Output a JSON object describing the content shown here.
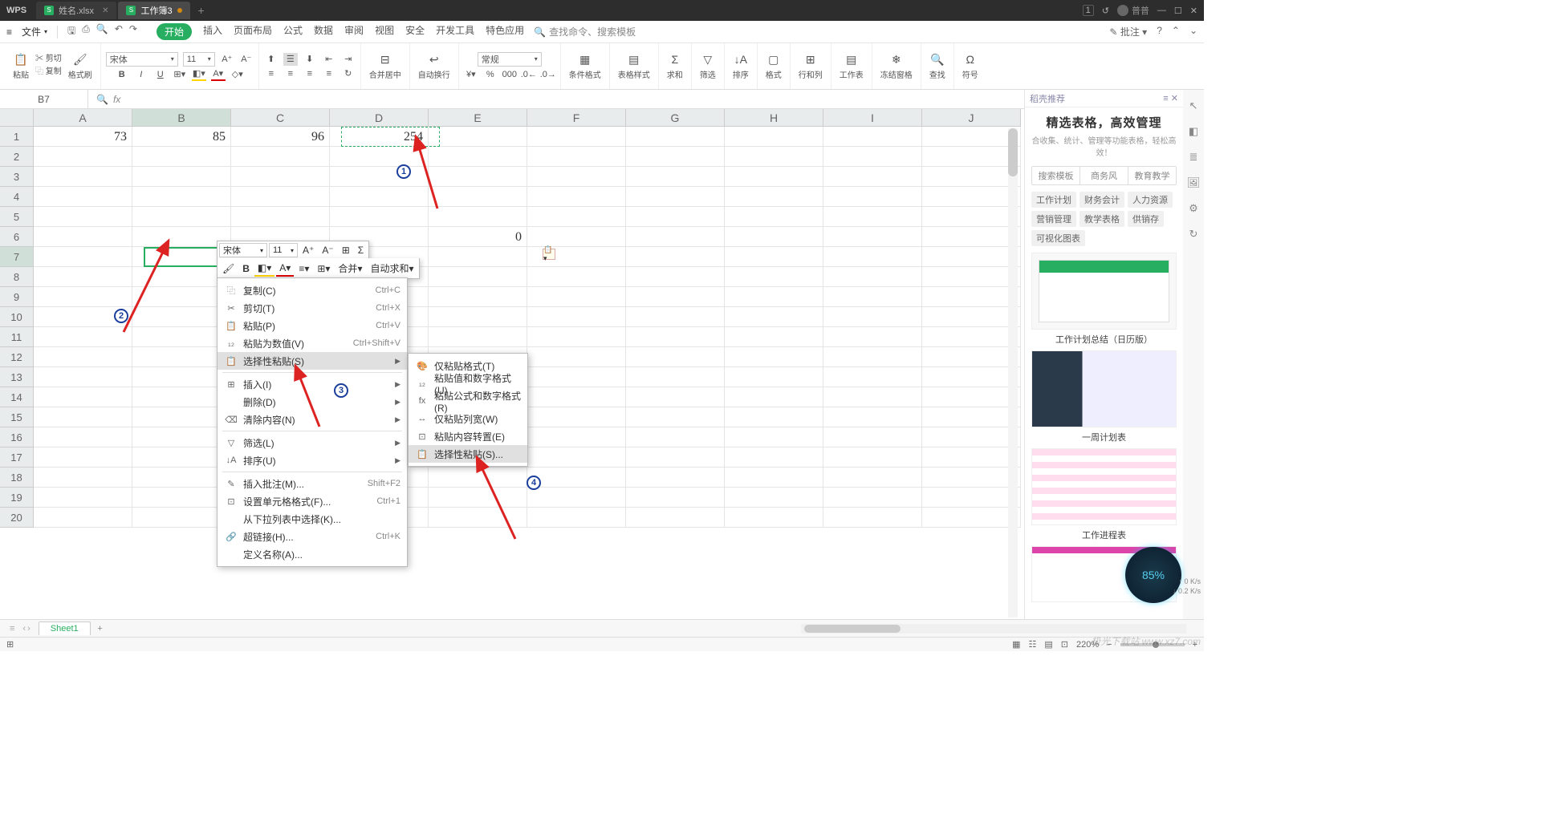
{
  "titlebar": {
    "app": "WPS",
    "tabs": [
      {
        "label": "姓名.xlsx",
        "active": false
      },
      {
        "label": "工作簿3",
        "active": true
      }
    ],
    "user": "普普",
    "badge": "1"
  },
  "menubar": {
    "file": "文件",
    "tabs": [
      "开始",
      "插入",
      "页面布局",
      "公式",
      "数据",
      "审阅",
      "视图",
      "安全",
      "开发工具",
      "特色应用"
    ],
    "activeTab": "开始",
    "searchPlaceholder": "查找命令、搜索模板",
    "right": "批注"
  },
  "ribbon": {
    "paste": "粘贴",
    "cut": "剪切",
    "copy": "复制",
    "formatPainter": "格式刷",
    "font": "宋体",
    "fontSize": "11",
    "mergeCenter": "合并居中",
    "wrap": "自动换行",
    "numberFormat": "常规",
    "cellStyle": "条件格式",
    "tableStyle": "表格样式",
    "sum": "求和",
    "filter": "筛选",
    "sort": "排序",
    "format": "格式",
    "rowcol": "行和列",
    "sheet": "工作表",
    "freeze": "冻结窗格",
    "find": "查找",
    "symbol": "符号"
  },
  "formulaBar": {
    "nameBox": "B7",
    "fx": "fx"
  },
  "columns": [
    "A",
    "B",
    "C",
    "D",
    "E",
    "F",
    "G",
    "H",
    "I",
    "J"
  ],
  "rows": 20,
  "cells": {
    "A1": "73",
    "B1": "85",
    "C1": "96",
    "D1": "254",
    "E6": "0"
  },
  "activeCell": "B7",
  "copiedCell": "D1",
  "miniToolbar": {
    "font": "宋体",
    "size": "11",
    "merge": "合并",
    "autoSum": "自动求和"
  },
  "contextMenu": [
    {
      "icon": "⿻",
      "label": "复制(C)",
      "shortcut": "Ctrl+C"
    },
    {
      "icon": "✂",
      "label": "剪切(T)",
      "shortcut": "Ctrl+X"
    },
    {
      "icon": "📋",
      "label": "粘贴(P)",
      "shortcut": "Ctrl+V"
    },
    {
      "icon": "₁₂",
      "label": "粘贴为数值(V)",
      "shortcut": "Ctrl+Shift+V"
    },
    {
      "icon": "📋",
      "label": "选择性粘贴(S)",
      "submenu": true,
      "hover": true
    },
    {
      "sep": true
    },
    {
      "icon": "⊞",
      "label": "插入(I)",
      "submenu": true
    },
    {
      "icon": "",
      "label": "删除(D)",
      "submenu": true
    },
    {
      "icon": "⌫",
      "label": "清除内容(N)",
      "submenu": true
    },
    {
      "sep": true
    },
    {
      "icon": "▽",
      "label": "筛选(L)",
      "submenu": true
    },
    {
      "icon": "↓A",
      "label": "排序(U)",
      "submenu": true
    },
    {
      "sep": true
    },
    {
      "icon": "✎",
      "label": "插入批注(M)...",
      "shortcut": "Shift+F2"
    },
    {
      "icon": "⊡",
      "label": "设置单元格格式(F)...",
      "shortcut": "Ctrl+1"
    },
    {
      "icon": "",
      "label": "从下拉列表中选择(K)..."
    },
    {
      "icon": "🔗",
      "label": "超链接(H)...",
      "shortcut": "Ctrl+K"
    },
    {
      "icon": "",
      "label": "定义名称(A)..."
    }
  ],
  "subMenu": [
    {
      "icon": "🎨",
      "label": "仅粘贴格式(T)"
    },
    {
      "icon": "₁₂",
      "label": "粘贴值和数字格式(U)"
    },
    {
      "icon": "fx",
      "label": "粘贴公式和数字格式(R)"
    },
    {
      "icon": "↔",
      "label": "仅粘贴列宽(W)"
    },
    {
      "icon": "⊡",
      "label": "粘贴内容转置(E)"
    },
    {
      "icon": "📋",
      "label": "选择性粘贴(S)...",
      "hover": true
    }
  ],
  "rightPanel": {
    "header": "稻壳推荐",
    "title": "精选表格，高效管理",
    "subtitle": "合收集、统计、管理等功能表格，轻松高效！",
    "tabs": [
      "搜索模板",
      "商务风",
      "教育教学"
    ],
    "tags": [
      "工作计划",
      "财务会计",
      "人力资源",
      "营销管理",
      "教学表格",
      "供销存",
      "可视化图表"
    ],
    "templateCaptions": [
      "",
      "工作计划总结（日历版）",
      "",
      "一周计划表",
      "",
      "工作进程表"
    ]
  },
  "sheetTabs": {
    "sheet": "Sheet1"
  },
  "statusBar": {
    "zoom": "220%"
  },
  "speed": {
    "pct": "85%",
    "up": "0 K/s",
    "down": "0.2 K/s"
  },
  "watermark": "极光下载站 www.xz7.com"
}
